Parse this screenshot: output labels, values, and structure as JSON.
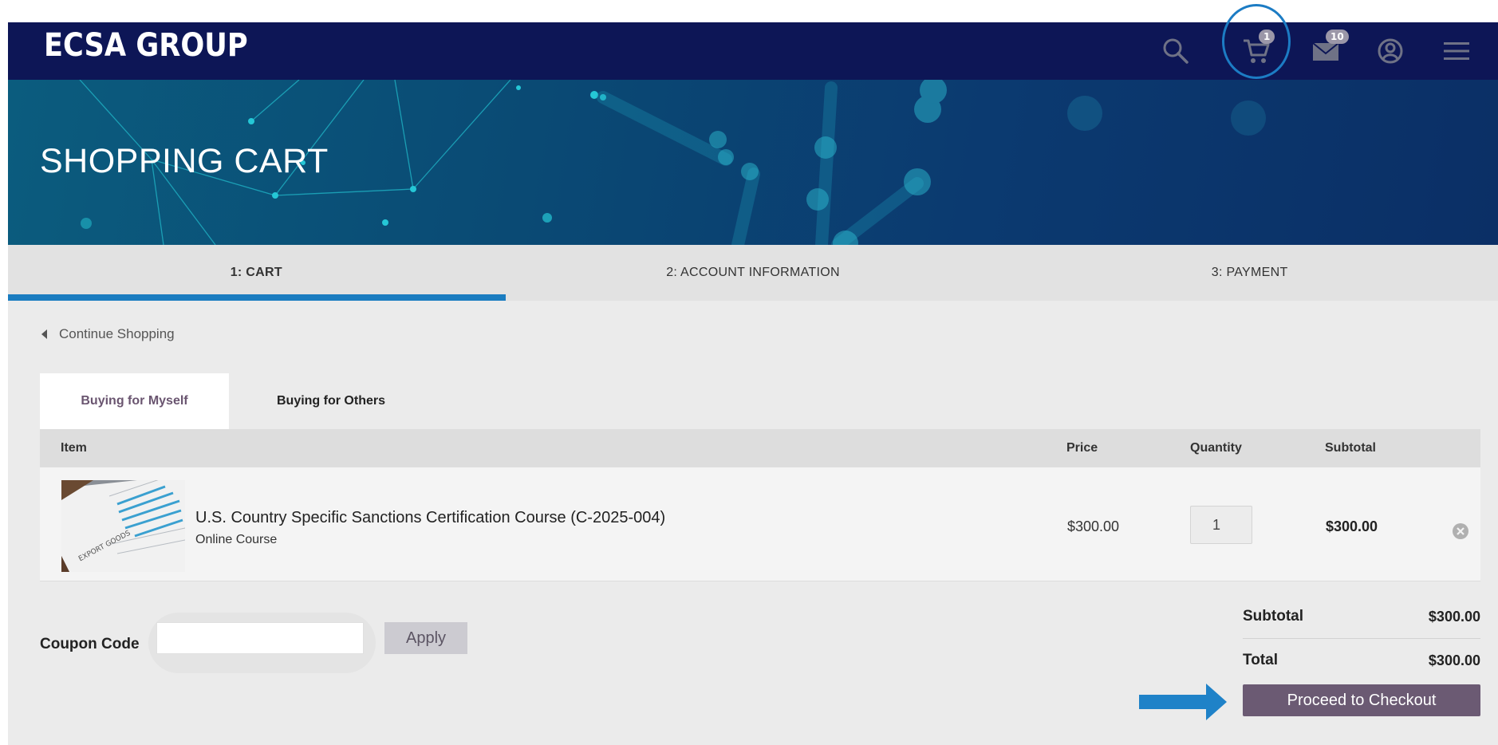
{
  "header": {
    "logo": "ECSA GROUP",
    "icons": [
      "search-icon",
      "cart-icon",
      "mail-icon",
      "account-icon",
      "menu-icon"
    ],
    "cart_count": "1",
    "mail_count": "10",
    "color": "#0d1656"
  },
  "banner": {
    "title": "SHOPPING CART"
  },
  "steps": [
    {
      "label": "1: CART"
    },
    {
      "label": "2: ACCOUNT INFORMATION"
    },
    {
      "label": "3: PAYMENT"
    }
  ],
  "continue_label": "Continue Shopping",
  "buying_tabs": {
    "myself": "Buying for Myself",
    "others": "Buying for Others"
  },
  "table": {
    "headers": {
      "item": "Item",
      "price": "Price",
      "quantity": "Quantity",
      "subtotal": "Subtotal"
    },
    "rows": [
      {
        "title": "U.S. Country Specific Sanctions Certification Course (C-2025-004)",
        "type": "Online Course",
        "price": "$300.00",
        "quantity": "1",
        "subtotal": "$300.00",
        "thumb_text": "EXPORT GOODS"
      }
    ]
  },
  "coupon": {
    "label": "Coupon Code",
    "value": "",
    "apply_label": "Apply"
  },
  "totals": {
    "subtotal_label": "Subtotal",
    "subtotal_value": "$300.00",
    "total_label": "Total",
    "total_value": "$300.00"
  },
  "checkout_label": "Proceed to Checkout",
  "colors": {
    "accent": "#1a7cc0",
    "checkout": "#6b5a73"
  }
}
